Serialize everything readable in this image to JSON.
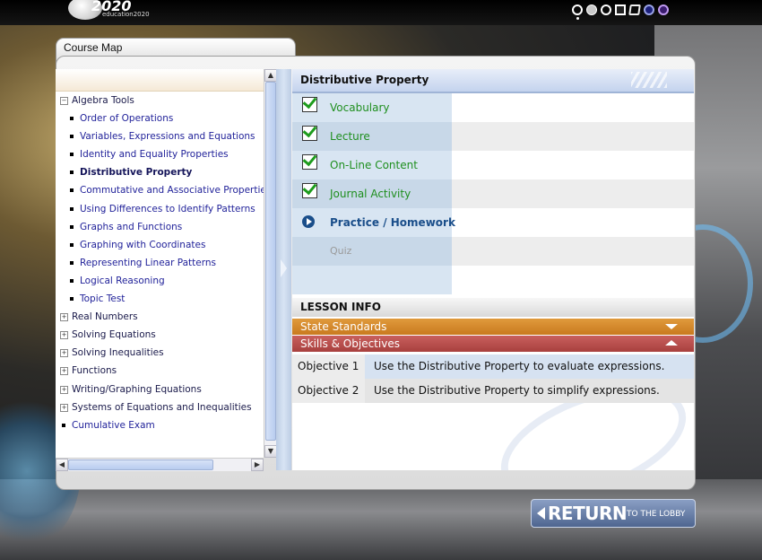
{
  "header": {
    "logo_text": "2020",
    "logo_sub": "education2020"
  },
  "course_map": {
    "title": "Course Map",
    "tree": [
      {
        "type": "node",
        "label": "Algebra Tools",
        "expanded": true
      },
      {
        "type": "child",
        "label": "Order of Operations"
      },
      {
        "type": "child",
        "label": "Variables, Expressions and Equations"
      },
      {
        "type": "child",
        "label": "Identity and Equality Properties"
      },
      {
        "type": "child",
        "label": "Distributive Property",
        "selected": true
      },
      {
        "type": "child",
        "label": "Commutative and Associative Properties"
      },
      {
        "type": "child",
        "label": "Using Differences to Identify Patterns"
      },
      {
        "type": "child",
        "label": "Graphs and Functions"
      },
      {
        "type": "child",
        "label": "Graphing with Coordinates"
      },
      {
        "type": "child",
        "label": "Representing Linear Patterns"
      },
      {
        "type": "child",
        "label": "Logical Reasoning"
      },
      {
        "type": "child",
        "label": "Topic Test"
      },
      {
        "type": "node",
        "label": "Real Numbers"
      },
      {
        "type": "node",
        "label": "Solving Equations"
      },
      {
        "type": "node",
        "label": "Solving Inequalities"
      },
      {
        "type": "node",
        "label": "Functions"
      },
      {
        "type": "node",
        "label": "Writing/Graphing Equations"
      },
      {
        "type": "node",
        "label": "Systems of Equations and Inequalities"
      },
      {
        "type": "leaf",
        "label": "Cumulative Exam"
      }
    ]
  },
  "lesson": {
    "title": "Distributive Property",
    "activities": [
      {
        "label": "Vocabulary",
        "status": "done"
      },
      {
        "label": "Lecture",
        "status": "done"
      },
      {
        "label": "On-Line Content",
        "status": "done"
      },
      {
        "label": "Journal Activity",
        "status": "done"
      },
      {
        "label": "Practice / Homework",
        "status": "current"
      },
      {
        "label": "Quiz",
        "status": "locked"
      }
    ]
  },
  "lesson_info": {
    "title": "LESSON INFO",
    "state_standards_label": "State Standards",
    "skills_label": "Skills & Objectives",
    "objectives": [
      {
        "key": "Objective 1",
        "text": "Use the Distributive Property to evaluate expressions."
      },
      {
        "key": "Objective 2",
        "text": "Use the Distributive Property to simplify expressions."
      }
    ]
  },
  "return_button": {
    "big": "RETURN",
    "small": "TO THE LOBBY"
  },
  "colors": {
    "accent": "#1a4e8a",
    "done_green": "#1f8f1f",
    "standards_orange": "#d48a2c",
    "skills_red": "#b84f4d"
  }
}
